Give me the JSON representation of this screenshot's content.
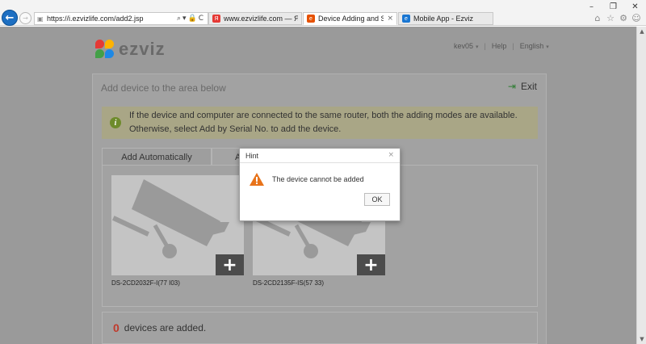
{
  "browser": {
    "address_url": "https://i.ezvizlife.com/add2.jsp",
    "address_controls": "⌕▾🔒C",
    "tabs": [
      {
        "label": "www.ezvizlife.com — Яндекс...",
        "icon": "yandex-icon",
        "color": "#e53935"
      },
      {
        "label": "Device Adding and Settings",
        "icon": "ezviz-icon",
        "color": "#e65100"
      },
      {
        "label": "Mobile App - Ezviz",
        "icon": "ezviz-icon",
        "color": "#1976d2"
      }
    ],
    "window_controls": [
      "–",
      "❐",
      "✕"
    ],
    "tool_icons": [
      "⌂",
      "☆",
      "⚙",
      "☺"
    ]
  },
  "header": {
    "logo_text": "ezviz",
    "username": "kev05",
    "help": "Help",
    "language": "English"
  },
  "card": {
    "title": "Add device to the area below",
    "exit_label": "Exit",
    "notice": "If the device and computer are connected to the same router, both the adding modes are available. Otherwise, select Add by Serial No. to add the device.",
    "tabs": {
      "auto": "Add Automatically",
      "other": "A"
    },
    "devices": [
      {
        "name": "DS-2CD2032F-I(77          I03)"
      },
      {
        "name": "DS-2CD2135F-IS(57          33)"
      }
    ],
    "added_count": "0",
    "added_text": "devices are added."
  },
  "modal": {
    "title": "Hint",
    "message": "The device cannot be added",
    "ok_label": "OK",
    "close": "×"
  },
  "colors": {
    "accent_blue": "#1d6fc2",
    "warning_orange": "#e8731a",
    "counter_red": "#c0392b"
  }
}
